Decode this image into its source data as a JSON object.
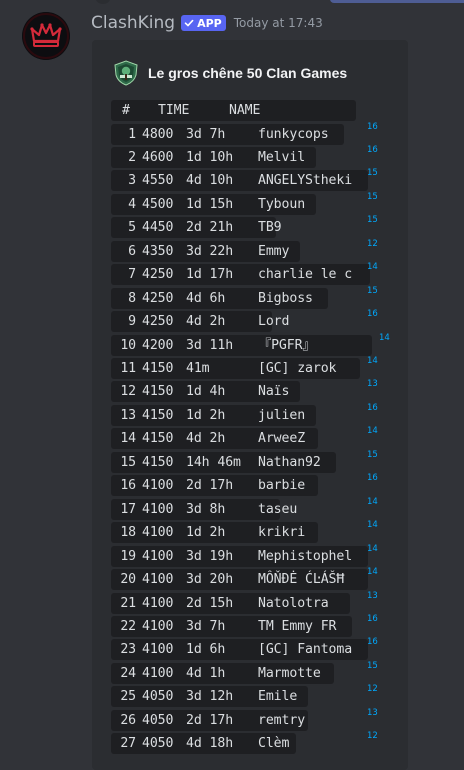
{
  "message": {
    "author": "ClashKing",
    "badge": "APP",
    "timestamp": "Today at 17:43"
  },
  "embed": {
    "title": "Le gros chêne 50 Clan Games",
    "header": {
      "rank": "#",
      "time": "TIME",
      "name": "NAME"
    },
    "rows": [
      {
        "rank": "1",
        "score": "4800",
        "time": "3d 7h",
        "name": "funkycops",
        "th": "16"
      },
      {
        "rank": "2",
        "score": "4600",
        "time": "1d 10h",
        "name": "Melvil",
        "th": "16"
      },
      {
        "rank": "3",
        "score": "4550",
        "time": "4d 10h",
        "name": "ANGELYStheki",
        "th": "15"
      },
      {
        "rank": "4",
        "score": "4500",
        "time": "1d 15h",
        "name": "Tyboun",
        "th": "15"
      },
      {
        "rank": "5",
        "score": "4450",
        "time": "2d 21h",
        "name": "TB9",
        "th": "15"
      },
      {
        "rank": "6",
        "score": "4350",
        "time": "3d 22h",
        "name": "Emmy",
        "th": "12"
      },
      {
        "rank": "7",
        "score": "4250",
        "time": "1d 17h",
        "name": "charlie le c",
        "th": "14"
      },
      {
        "rank": "8",
        "score": "4250",
        "time": "4d 6h",
        "name": "Bigboss",
        "th": "15"
      },
      {
        "rank": "9",
        "score": "4250",
        "time": "4d 2h",
        "name": "Lord",
        "th": "16"
      },
      {
        "rank": "10",
        "score": "4200",
        "time": "3d 11h",
        "name": "『PGFR』",
        "th": "14"
      },
      {
        "rank": "11",
        "score": "4150",
        "time": "41m",
        "name": "[GC] zarok",
        "th": "14"
      },
      {
        "rank": "12",
        "score": "4150",
        "time": "1d 4h",
        "name": "Naïs",
        "th": "13"
      },
      {
        "rank": "13",
        "score": "4150",
        "time": "1d 2h",
        "name": "julien",
        "th": "16"
      },
      {
        "rank": "14",
        "score": "4150",
        "time": "4d 2h",
        "name": "ArweeZ",
        "th": "14"
      },
      {
        "rank": "15",
        "score": "4150",
        "time": "14h 46m",
        "name": "Nathan92",
        "th": "15"
      },
      {
        "rank": "16",
        "score": "4100",
        "time": "2d 17h",
        "name": "barbie",
        "th": "16"
      },
      {
        "rank": "17",
        "score": "4100",
        "time": "3d 8h",
        "name": "taseu",
        "th": "14"
      },
      {
        "rank": "18",
        "score": "4100",
        "time": "1d 2h",
        "name": "krikri",
        "th": "14"
      },
      {
        "rank": "19",
        "score": "4100",
        "time": "3d 19h",
        "name": "Mephistophel",
        "th": "14"
      },
      {
        "rank": "20",
        "score": "4100",
        "time": "3d 20h",
        "name": "MÔŇĐĖ ĆĿÁŠĦ",
        "th": "14"
      },
      {
        "rank": "21",
        "score": "4100",
        "time": "2d 15h",
        "name": "Natolotra",
        "th": "13"
      },
      {
        "rank": "22",
        "score": "4100",
        "time": "3d 7h",
        "name": "TM Emmy FR",
        "th": "16"
      },
      {
        "rank": "23",
        "score": "4100",
        "time": "1d 6h",
        "name": "[GC] Fantoma",
        "th": "16"
      },
      {
        "rank": "24",
        "score": "4100",
        "time": "4d 1h",
        "name": "Marmotte",
        "th": "15"
      },
      {
        "rank": "25",
        "score": "4050",
        "time": "3d 12h",
        "name": "Emile",
        "th": "12"
      },
      {
        "rank": "26",
        "score": "4050",
        "time": "2d 17h",
        "name": "remtry",
        "th": "13"
      },
      {
        "rank": "27",
        "score": "4050",
        "time": "4d 18h",
        "name": "Clèm",
        "th": "12"
      }
    ]
  },
  "icons": {
    "avatar": "crown-avatar-icon",
    "badge_check": "check-icon",
    "clan": "clan-badge-icon"
  },
  "colors": {
    "background": "#313338",
    "embed_background": "#2b2d31",
    "code_background": "#1e1f22",
    "app_badge": "#5865f2",
    "superscript": "#00a8fc",
    "crown": "#d42a3a"
  }
}
